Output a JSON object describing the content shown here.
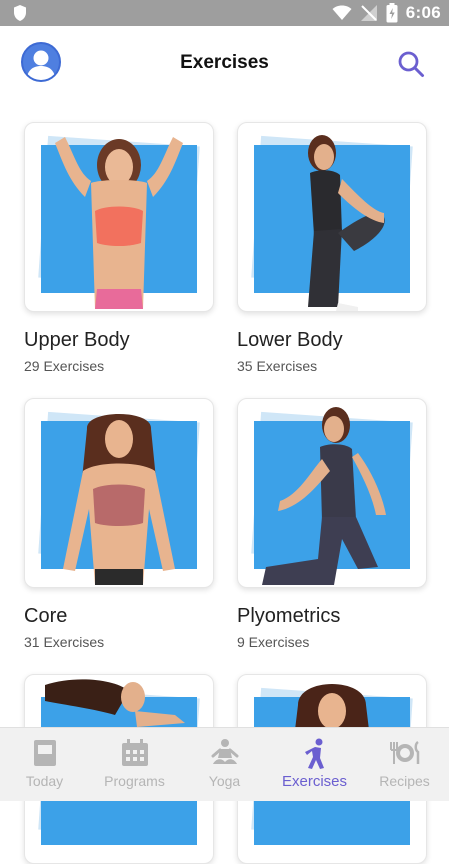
{
  "status_bar": {
    "time": "6:06"
  },
  "header": {
    "title": "Exercises"
  },
  "cards": [
    {
      "title": "Upper Body",
      "subtitle": "29 Exercises"
    },
    {
      "title": "Lower Body",
      "subtitle": "35 Exercises"
    },
    {
      "title": "Core",
      "subtitle": "31 Exercises"
    },
    {
      "title": "Plyometrics",
      "subtitle": "9 Exercises"
    }
  ],
  "bottom_nav": [
    {
      "label": "Today",
      "icon": "book-icon",
      "active": false
    },
    {
      "label": "Programs",
      "icon": "calendar-icon",
      "active": false
    },
    {
      "label": "Yoga",
      "icon": "yoga-icon",
      "active": false
    },
    {
      "label": "Exercises",
      "icon": "exercise-icon",
      "active": true
    },
    {
      "label": "Recipes",
      "icon": "dining-icon",
      "active": false
    }
  ],
  "colors": {
    "accent": "#6b5fd0",
    "tile_blue": "#3ca1e8",
    "status_bar": "#9e9e9e",
    "nav_inactive": "#b5b5b5"
  }
}
